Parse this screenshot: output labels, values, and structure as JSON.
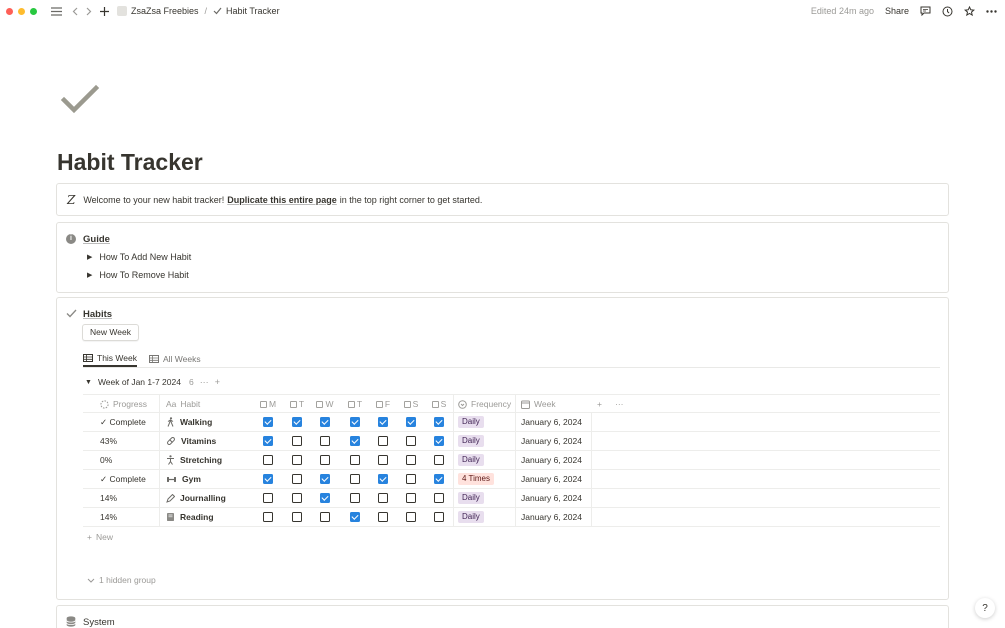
{
  "topbar": {
    "workspace": "ZsaZsa Freebies",
    "separator": "/",
    "page": "Habit Tracker",
    "edited": "Edited 24m ago",
    "share": "Share"
  },
  "page": {
    "title": "Habit Tracker",
    "icon": "check-icon"
  },
  "callout": {
    "icon_letter": "Z",
    "text_before": "Welcome to your new habit tracker!",
    "link": "Duplicate this entire page",
    "text_after": "in the top right corner to get started."
  },
  "guide": {
    "title": "Guide",
    "items": [
      "How To Add New Habit",
      "How To Remove Habit"
    ]
  },
  "habits": {
    "title": "Habits",
    "new_week_button": "New Week",
    "tabs": [
      "This Week",
      "All Weeks"
    ],
    "group": {
      "name": "Week of Jan 1-7 2024",
      "count": "6",
      "more": "···",
      "add": "+"
    },
    "columns": {
      "progress": "Progress",
      "habit": "Habit",
      "habit_prefix": "Aa",
      "days": [
        "M",
        "T",
        "W",
        "T",
        "F",
        "S",
        "S"
      ],
      "frequency": "Frequency",
      "week": "Week",
      "add": "+",
      "more": "···"
    },
    "rows": [
      {
        "progress": "✓ Complete",
        "habit": "Walking",
        "icon": "walking-icon",
        "days": [
          true,
          true,
          true,
          true,
          true,
          true,
          true
        ],
        "frequency": "Daily",
        "freq_color": "#e8deee",
        "week": "January 6, 2024"
      },
      {
        "progress": "43%",
        "habit": "Vitamins",
        "icon": "pill-icon",
        "days": [
          true,
          false,
          false,
          true,
          false,
          false,
          true
        ],
        "frequency": "Daily",
        "freq_color": "#e8deee",
        "week": "January 6, 2024"
      },
      {
        "progress": "0%",
        "habit": "Stretching",
        "icon": "stretching-icon",
        "days": [
          false,
          false,
          false,
          false,
          false,
          false,
          false
        ],
        "frequency": "Daily",
        "freq_color": "#e8deee",
        "week": "January 6, 2024"
      },
      {
        "progress": "✓ Complete",
        "habit": "Gym",
        "icon": "dumbbell-icon",
        "days": [
          true,
          false,
          true,
          false,
          true,
          false,
          true
        ],
        "frequency": "4 Times",
        "freq_color": "#ffe2dd",
        "week": "January 6, 2024"
      },
      {
        "progress": "14%",
        "habit": "Journalling",
        "icon": "pen-icon",
        "days": [
          false,
          false,
          true,
          false,
          false,
          false,
          false
        ],
        "frequency": "Daily",
        "freq_color": "#e8deee",
        "week": "January 6, 2024"
      },
      {
        "progress": "14%",
        "habit": "Reading",
        "icon": "book-icon",
        "days": [
          false,
          false,
          false,
          true,
          false,
          false,
          false
        ],
        "frequency": "Daily",
        "freq_color": "#e8deee",
        "week": "January 6, 2024"
      }
    ],
    "new_row": "New",
    "hidden_group": "1 hidden group"
  },
  "system": {
    "title": "System"
  },
  "help": "?"
}
